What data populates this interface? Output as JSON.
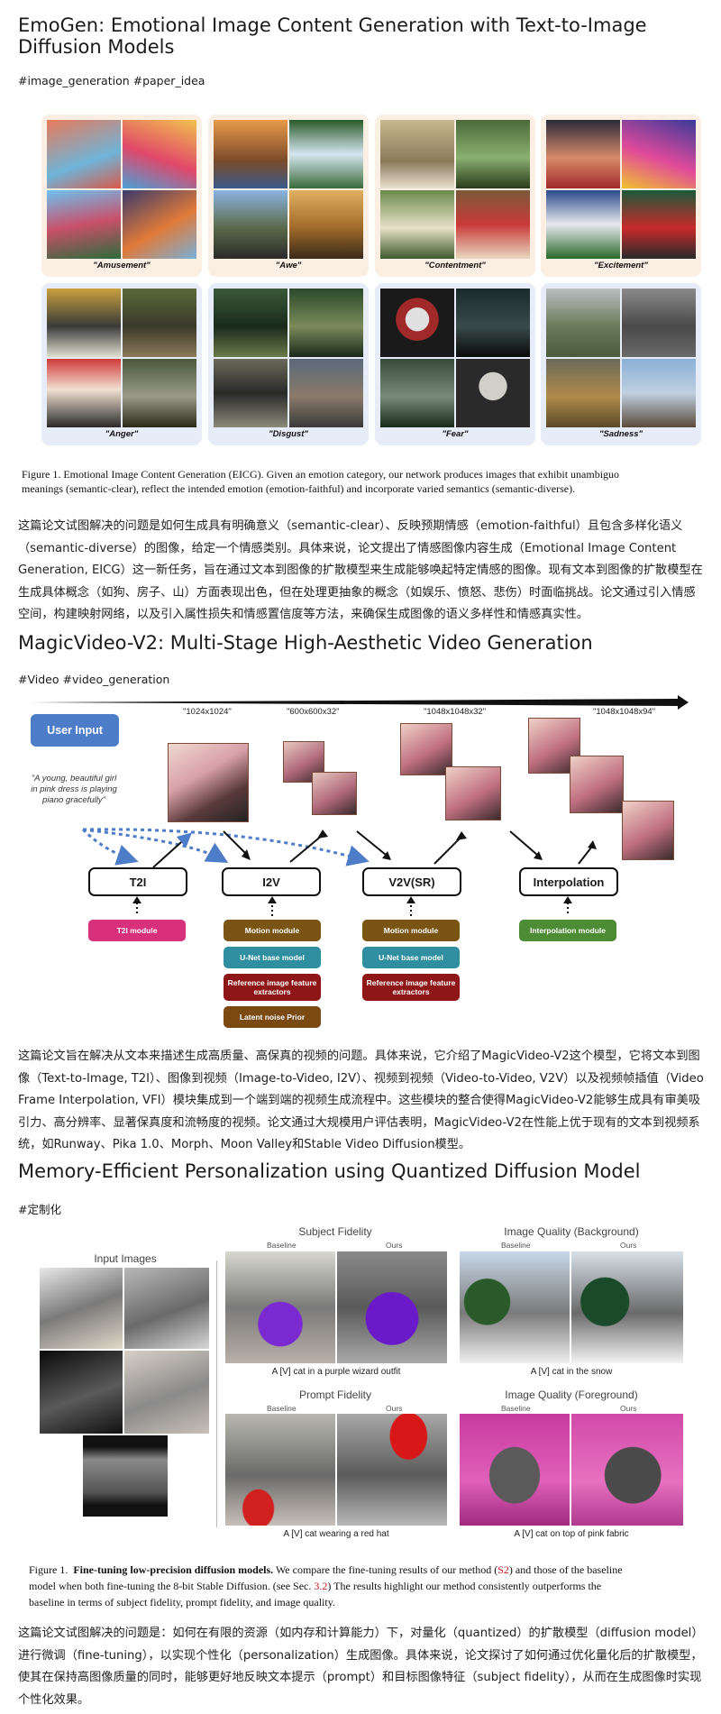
{
  "sections": [
    {
      "title": "EmoGen: Emotional Image Content Generation with Text-to-Image Diffusion Models",
      "tags": "#image_generation #paper_idea",
      "figure": {
        "panels": [
          "\"Amusement\"",
          "\"Awe\"",
          "\"Contentment\"",
          "\"Excitement\"",
          "\"Anger\"",
          "\"Disgust\"",
          "\"Fear\"",
          "\"Sadness\""
        ],
        "caption_line1": "Figure 1. Emotional Image Content Generation (EICG). Given an emotion category, our network produces images that exhibit unambiguo",
        "caption_line2": "meanings (semantic-clear), reflect the intended emotion (emotion-faithful) and incorporate varied semantics (semantic-diverse)."
      },
      "summary": "这篇论文试图解决的问题是如何生成具有明确意义（semantic-clear）、反映预期情感（emotion-faithful）且包含多样化语义（semantic-diverse）的图像，给定一个情感类别。具体来说，论文提出了情感图像内容生成（Emotional Image Content Generation, EICG）这一新任务，旨在通过文本到图像的扩散模型来生成能够唤起特定情感的图像。现有文本到图像的扩散模型在生成具体概念（如狗、房子、山）方面表现出色，但在处理更抽象的概念（如娱乐、愤怒、悲伤）时面临挑战。论文通过引入情感空间，构建映射网络，以及引入属性损失和情感置信度等方法，来确保生成图像的语义多样性和情感真实性。"
    },
    {
      "title": "MagicVideo-V2: Multi-Stage High-Aesthetic Video Generation",
      "tags": "#Video #video_generation",
      "figure": {
        "resolutions": [
          "\"1024x1024\"",
          "\"600x600x32\"",
          "\"1048x1048x32\"",
          "\"1048x1048x94\""
        ],
        "user_input": "User Input",
        "prompt": "\"A young, beautiful girl in pink dress is playing piano gracefully\"",
        "stages": [
          "T2I",
          "I2V",
          "V2V(SR)",
          "Interpolation"
        ],
        "t2i_module": "T2I module",
        "i2v_modules": [
          "Motion module",
          "U-Net base model",
          "Reference image feature extractors",
          "Latent noise Prior"
        ],
        "v2v_modules": [
          "Motion module",
          "U-Net base model",
          "Reference image feature extractors"
        ],
        "interp_module": "Interpolation module"
      },
      "summary": "这篇论文旨在解决从文本来描述生成高质量、高保真的视频的问题。具体来说，它介绍了MagicVideo-V2这个模型，它将文本到图像（Text-to-Image, T2I）、图像到视频（Image-to-Video, I2V）、视频到视频（Video-to-Video, V2V）以及视频帧插值（Video Frame Interpolation, VFI）模块集成到一个端到端的视频生成流程中。这些模块的整合使得MagicVideo-V2能够生成具有审美吸引力、高分辨率、显著保真度和流畅度的视频。论文通过大规模用户评估表明，MagicVideo-V2在性能上优于现有的文本到视频系统，如Runway、Pika 1.0、Morph、Moon Valley和Stable Video Diffusion模型。"
    },
    {
      "title": "Memory-Efficient Personalization using Quantized Diffusion Model",
      "tags": "#定制化",
      "figure": {
        "input_images": "Input Images",
        "subject_fidelity": "Subject Fidelity",
        "quality_background": "Image Quality (Background)",
        "prompt_fidelity": "Prompt Fidelity",
        "quality_foreground": "Image Quality (Foreground)",
        "baseline": "Baseline",
        "ours": "Ours",
        "prompts": [
          "A [V] cat in a purple wizard outfit",
          "A [V] cat in the snow",
          "A [V] cat wearing a red hat",
          "A [V] cat on top of pink fabric"
        ],
        "caption_a": "Figure 1.",
        "caption_b": "Fine-tuning low-precision diffusion models.",
        "caption_c": " We compare the fine-tuning results of our method (",
        "caption_s2": "S2",
        "caption_d": ") and those of the baseline",
        "caption_line2a": "model when both fine-tuning the 8-bit Stable Diffusion. (see Sec. ",
        "caption_sec": "3.2",
        "caption_line2b": ") The results highlight our method consistently outperforms the",
        "caption_line3": "baseline in terms of subject fidelity, prompt fidelity, and image quality."
      },
      "summary": "这篇论文试图解决的问题是：如何在有限的资源（如内存和计算能力）下，对量化（quantized）的扩散模型（diffusion model）进行微调（fine-tuning），以实现个性化（personalization）生成图像。具体来说，论文探讨了如何通过优化量化后的扩散模型，使其在保持高图像质量的同时，能够更好地反映文本提示（prompt）和目标图像特征（subject fidelity），从而在生成图像时实现个性化效果。"
    }
  ],
  "colors": {
    "user_input": "#4d7cc9",
    "t2i_module": "#d8307a",
    "motion_module": "#7a5412",
    "unet_module": "#2f8fa0",
    "ref_module": "#8e1616",
    "noise_module": "#7a4a12",
    "interp_module": "#4c8c34",
    "red_ref": "#c41e1e"
  }
}
